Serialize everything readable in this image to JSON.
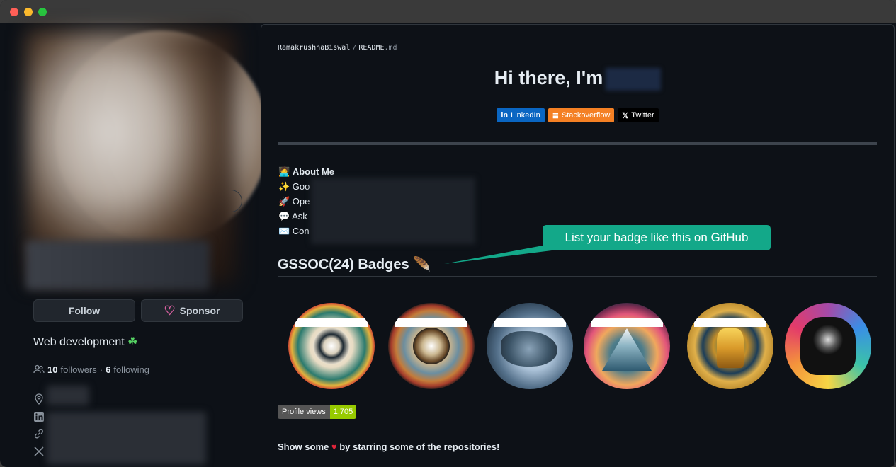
{
  "window": {
    "controls": [
      "close",
      "minimize",
      "maximize"
    ]
  },
  "profile": {
    "follow_label": "Follow",
    "sponsor_label": "Sponsor",
    "bio": "Web development",
    "bio_icon": "shamrock-icon",
    "followers_count": "10",
    "followers_label": "followers",
    "following_count": "6",
    "following_label": "following",
    "side_icons": [
      "location-icon",
      "linkedin-icon",
      "link-icon",
      "x-icon"
    ]
  },
  "readme": {
    "user": "RamakrushnaBiswal",
    "separator": "/",
    "file_name": "README",
    "file_ext": ".md",
    "title": "Hi there, I'm",
    "social_badges": [
      {
        "label": "LinkedIn",
        "color": "#0a66c2"
      },
      {
        "label": "Stackoverflow",
        "color": "#f48024"
      },
      {
        "label": "Twitter",
        "color": "#000000"
      }
    ],
    "about": {
      "heading": "About Me",
      "lines": [
        "✨ Goo",
        "🚀 Ope",
        "💬 Ask",
        "✉️ Con"
      ]
    },
    "callout": "List your badge like this on GitHub",
    "badges_heading": "GSSOC(24) Badges",
    "profile_views_label": "Profile views",
    "profile_views_value": "1,705",
    "footer_before": "Show some",
    "footer_after": "by starring some of the repositories!"
  }
}
